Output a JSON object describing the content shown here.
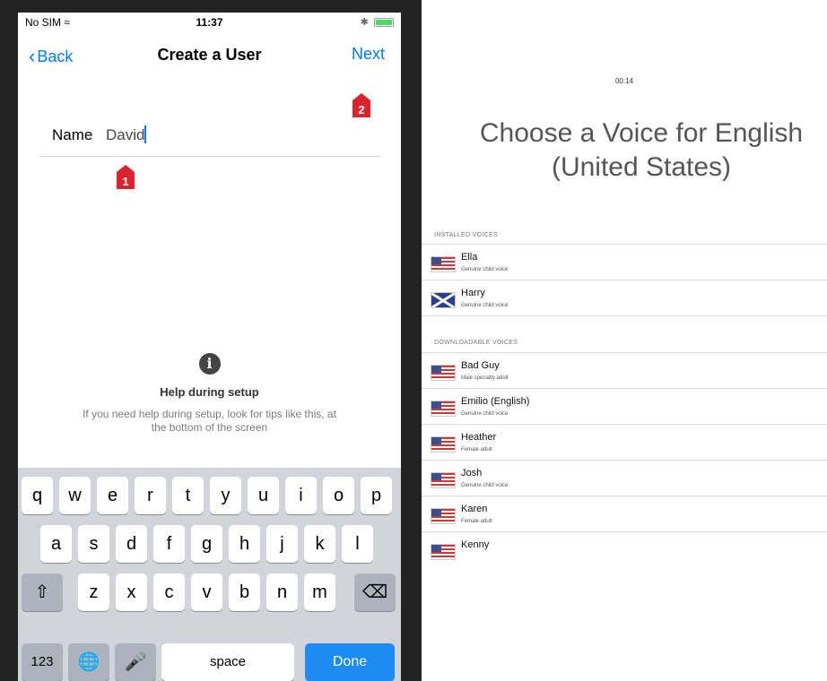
{
  "phone": {
    "status": {
      "carrier": "No SIM",
      "time": "11:37"
    },
    "nav": {
      "back": "Back",
      "title": "Create a User",
      "next": "Next"
    },
    "markers": {
      "one": "1",
      "two": "2"
    },
    "name_field": {
      "label": "Name",
      "value": "David"
    },
    "help": {
      "icon": "i",
      "title": "Help during setup",
      "desc": "If you need help during setup, look for tips like this, at the bottom of the screen"
    },
    "keyboard": {
      "row1": [
        "q",
        "w",
        "e",
        "r",
        "t",
        "y",
        "u",
        "i",
        "o",
        "p"
      ],
      "row2": [
        "a",
        "s",
        "d",
        "f",
        "g",
        "h",
        "j",
        "k",
        "l"
      ],
      "row3": [
        "z",
        "x",
        "c",
        "v",
        "b",
        "n",
        "m"
      ],
      "numbers": "123",
      "space": "space",
      "done": "Done"
    }
  },
  "voices": {
    "timer": "00:14",
    "title": "Choose a Voice for English (United States)",
    "installed_header": "INSTALLED VOICES",
    "installed": [
      {
        "name": "Ella",
        "desc": "Genuine child voice",
        "flag": "us"
      },
      {
        "name": "Harry",
        "desc": "Genuine child voice",
        "flag": "uk"
      }
    ],
    "downloadable_header": "DOWNLOADABLE VOICES",
    "downloadable": [
      {
        "name": "Bad Guy",
        "desc": "Male specialty adult",
        "flag": "us"
      },
      {
        "name": "Emilio (English)",
        "desc": "Genuine child voice",
        "flag": "us"
      },
      {
        "name": "Heather",
        "desc": "Female adult",
        "flag": "us"
      },
      {
        "name": "Josh",
        "desc": "Genuine child voice",
        "flag": "us"
      },
      {
        "name": "Karen",
        "desc": "Female adult",
        "flag": "us"
      },
      {
        "name": "Kenny",
        "desc": "",
        "flag": "us"
      }
    ]
  }
}
